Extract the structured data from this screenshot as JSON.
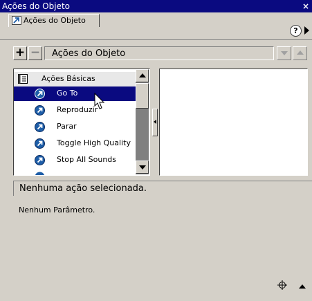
{
  "window": {
    "title": "Ações do Objeto",
    "close_glyph": "×"
  },
  "tab": {
    "label": "Ações do Objeto",
    "icon": "arrow-cursor-icon"
  },
  "toolbar": {
    "add_label": "+",
    "remove_label": "−",
    "dropdown_label": "Ações do Objeto",
    "help_label": "?"
  },
  "action_list": {
    "category": {
      "label": "Ações Básicas",
      "icon": "book-icon"
    },
    "items": [
      {
        "label": "Go To",
        "selected": true,
        "icon": "action-arrow-icon"
      },
      {
        "label": "Reproduzir",
        "selected": false,
        "icon": "action-arrow-icon"
      },
      {
        "label": "Parar",
        "selected": false,
        "icon": "action-arrow-icon"
      },
      {
        "label": "Toggle High Quality",
        "selected": false,
        "icon": "action-arrow-icon"
      },
      {
        "label": "Stop All Sounds",
        "selected": false,
        "icon": "action-arrow-icon"
      }
    ]
  },
  "status": {
    "text": "Nenhuma ação selecionada."
  },
  "parameters": {
    "text": "Nenhum Parâmetro."
  },
  "colors": {
    "titlebar": "#0a0a80",
    "panel": "#d4d0c8",
    "selection": "#0a0a80",
    "icon_blue": "#1e5ea8"
  }
}
